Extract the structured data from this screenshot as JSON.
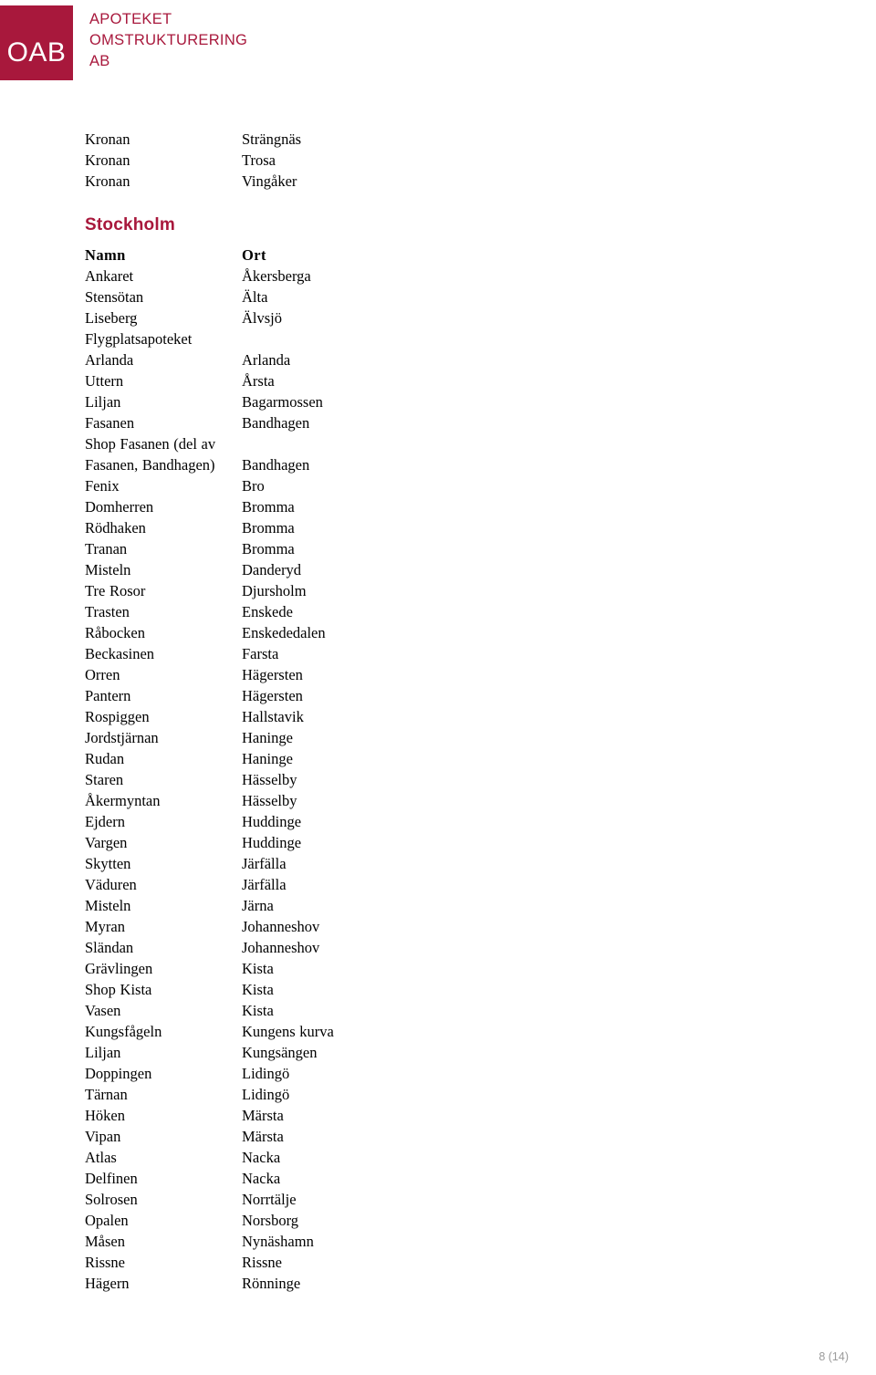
{
  "logo": {
    "mark_text": "OAB",
    "mark_color": "#A8183C",
    "line1": "APOTEKET",
    "line2": "OMSTRUKTURERING",
    "line3": "AB",
    "text_color": "#A8183C"
  },
  "top_table": {
    "rows": [
      {
        "name": "Kronan",
        "ort": "Strängnäs"
      },
      {
        "name": "Kronan",
        "ort": "Trosa"
      },
      {
        "name": "Kronan",
        "ort": "Vingåker"
      }
    ]
  },
  "section": {
    "heading": "Stockholm",
    "heading_color": "#A8183C"
  },
  "stockholm_table": {
    "headers": {
      "name": "Namn",
      "ort": "Ort"
    },
    "rows": [
      {
        "name": "Ankaret",
        "ort": "Åkersberga"
      },
      {
        "name": "Stensötan",
        "ort": "Älta"
      },
      {
        "name": "Liseberg",
        "ort": "Älvsjö"
      },
      {
        "name": "Flygplatsapoteket Arlanda",
        "ort": "Arlanda",
        "wrapped": true
      },
      {
        "name": "Uttern",
        "ort": "Årsta"
      },
      {
        "name": "Liljan",
        "ort": "Bagarmossen"
      },
      {
        "name": "Fasanen",
        "ort": "Bandhagen"
      },
      {
        "name": "Shop Fasanen (del av Fasanen, Bandhagen)",
        "ort": "Bandhagen",
        "wrapped": true
      },
      {
        "name": "Fenix",
        "ort": "Bro"
      },
      {
        "name": "Domherren",
        "ort": "Bromma"
      },
      {
        "name": "Rödhaken",
        "ort": "Bromma"
      },
      {
        "name": "Tranan",
        "ort": "Bromma"
      },
      {
        "name": "Misteln",
        "ort": "Danderyd"
      },
      {
        "name": "Tre Rosor",
        "ort": "Djursholm"
      },
      {
        "name": "Trasten",
        "ort": "Enskede"
      },
      {
        "name": "Råbocken",
        "ort": "Enskededalen"
      },
      {
        "name": "Beckasinen",
        "ort": "Farsta"
      },
      {
        "name": "Orren",
        "ort": "Hägersten"
      },
      {
        "name": "Pantern",
        "ort": "Hägersten"
      },
      {
        "name": "Rospiggen",
        "ort": "Hallstavik"
      },
      {
        "name": "Jordstjärnan",
        "ort": "Haninge"
      },
      {
        "name": "Rudan",
        "ort": "Haninge"
      },
      {
        "name": "Staren",
        "ort": "Hässelby"
      },
      {
        "name": "Åkermyntan",
        "ort": "Hässelby"
      },
      {
        "name": "Ejdern",
        "ort": "Huddinge"
      },
      {
        "name": "Vargen",
        "ort": "Huddinge"
      },
      {
        "name": "Skytten",
        "ort": "Järfälla"
      },
      {
        "name": "Väduren",
        "ort": "Järfälla"
      },
      {
        "name": "Misteln",
        "ort": "Järna"
      },
      {
        "name": "Myran",
        "ort": "Johanneshov"
      },
      {
        "name": "Sländan",
        "ort": "Johanneshov"
      },
      {
        "name": "Grävlingen",
        "ort": "Kista"
      },
      {
        "name": "Shop Kista",
        "ort": "Kista"
      },
      {
        "name": "Vasen",
        "ort": "Kista"
      },
      {
        "name": "Kungsfågeln",
        "ort": "Kungens kurva"
      },
      {
        "name": "Liljan",
        "ort": "Kungsängen"
      },
      {
        "name": "Doppingen",
        "ort": "Lidingö"
      },
      {
        "name": "Tärnan",
        "ort": "Lidingö"
      },
      {
        "name": "Höken",
        "ort": "Märsta"
      },
      {
        "name": "Vipan",
        "ort": "Märsta"
      },
      {
        "name": "Atlas",
        "ort": "Nacka"
      },
      {
        "name": "Delfinen",
        "ort": "Nacka"
      },
      {
        "name": "Solrosen",
        "ort": "Norrtälje"
      },
      {
        "name": "Opalen",
        "ort": "Norsborg"
      },
      {
        "name": "Måsen",
        "ort": "Nynäshamn"
      },
      {
        "name": "Rissne",
        "ort": "Rissne"
      },
      {
        "name": "Hägern",
        "ort": "Rönninge"
      }
    ]
  },
  "footer": {
    "page_label": "8 (14)"
  }
}
